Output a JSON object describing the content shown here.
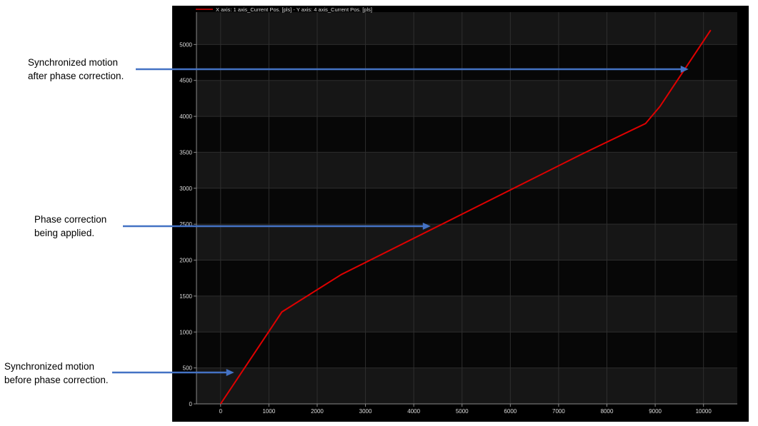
{
  "annotations": [
    {
      "lines": [
        "Synchronized motion",
        "after phase correction."
      ],
      "target": {
        "x": 9690,
        "y": 4700
      }
    },
    {
      "lines": [
        "Phase correction",
        "being applied."
      ],
      "target": {
        "x": 4350,
        "y": 2500
      }
    },
    {
      "lines": [
        "Synchronized motion",
        "before phase correction."
      ],
      "target": {
        "x": 280,
        "y": 440
      }
    }
  ],
  "colors": {
    "panel_background": "#000000",
    "band_light": "#161616",
    "band_dark": "#070707",
    "grid": "#2e2e2e",
    "axis": "#8a8a8a",
    "tick_label": "#dcdcdc",
    "series": "#e00000",
    "arrow": "#4472c4"
  },
  "chart_data": {
    "type": "line",
    "legend": {
      "text": "X axis: 1 axis_Current Pos. [pls] - Y axis: 4 axis_Current Pos. [pls]",
      "placement": "top-left"
    },
    "xlim": [
      -500,
      10700
    ],
    "ylim": [
      0,
      5450
    ],
    "xticks": [
      0,
      1000,
      2000,
      3000,
      4000,
      5000,
      6000,
      7000,
      8000,
      9000,
      10000
    ],
    "yticks": [
      0,
      500,
      1000,
      1500,
      2000,
      2500,
      3000,
      3500,
      4000,
      4500,
      5000
    ],
    "grid": true,
    "series": [
      {
        "color": "#e00000",
        "points": [
          [
            0,
            0
          ],
          [
            1270,
            1280
          ],
          [
            2500,
            1800
          ],
          [
            5000,
            2640
          ],
          [
            7500,
            3480
          ],
          [
            8800,
            3900
          ],
          [
            9100,
            4140
          ],
          [
            10150,
            5200
          ]
        ]
      }
    ]
  }
}
